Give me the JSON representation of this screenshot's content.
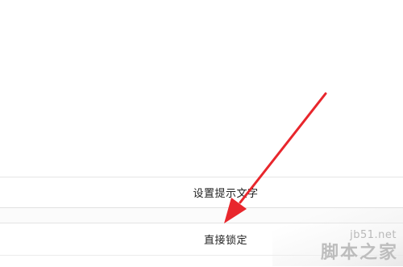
{
  "menu": {
    "items": [
      {
        "label": "设置提示文字"
      },
      {
        "label": "直接锁定"
      }
    ]
  },
  "annotation": {
    "arrow_color": "#e8262c"
  },
  "watermark": {
    "url": "jb51.net",
    "name": "脚本之家"
  }
}
